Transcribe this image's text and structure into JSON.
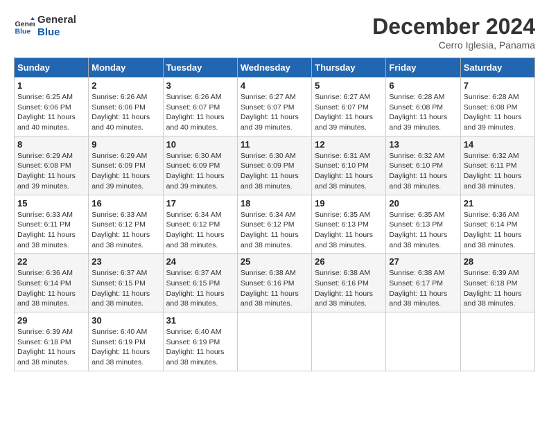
{
  "header": {
    "logo_general": "General",
    "logo_blue": "Blue",
    "month_year": "December 2024",
    "location": "Cerro Iglesia, Panama"
  },
  "columns": [
    "Sunday",
    "Monday",
    "Tuesday",
    "Wednesday",
    "Thursday",
    "Friday",
    "Saturday"
  ],
  "weeks": [
    [
      {
        "day": "1",
        "info": "Sunrise: 6:25 AM\nSunset: 6:06 PM\nDaylight: 11 hours and 40 minutes."
      },
      {
        "day": "2",
        "info": "Sunrise: 6:26 AM\nSunset: 6:06 PM\nDaylight: 11 hours and 40 minutes."
      },
      {
        "day": "3",
        "info": "Sunrise: 6:26 AM\nSunset: 6:07 PM\nDaylight: 11 hours and 40 minutes."
      },
      {
        "day": "4",
        "info": "Sunrise: 6:27 AM\nSunset: 6:07 PM\nDaylight: 11 hours and 39 minutes."
      },
      {
        "day": "5",
        "info": "Sunrise: 6:27 AM\nSunset: 6:07 PM\nDaylight: 11 hours and 39 minutes."
      },
      {
        "day": "6",
        "info": "Sunrise: 6:28 AM\nSunset: 6:08 PM\nDaylight: 11 hours and 39 minutes."
      },
      {
        "day": "7",
        "info": "Sunrise: 6:28 AM\nSunset: 6:08 PM\nDaylight: 11 hours and 39 minutes."
      }
    ],
    [
      {
        "day": "8",
        "info": "Sunrise: 6:29 AM\nSunset: 6:08 PM\nDaylight: 11 hours and 39 minutes."
      },
      {
        "day": "9",
        "info": "Sunrise: 6:29 AM\nSunset: 6:09 PM\nDaylight: 11 hours and 39 minutes."
      },
      {
        "day": "10",
        "info": "Sunrise: 6:30 AM\nSunset: 6:09 PM\nDaylight: 11 hours and 39 minutes."
      },
      {
        "day": "11",
        "info": "Sunrise: 6:30 AM\nSunset: 6:09 PM\nDaylight: 11 hours and 38 minutes."
      },
      {
        "day": "12",
        "info": "Sunrise: 6:31 AM\nSunset: 6:10 PM\nDaylight: 11 hours and 38 minutes."
      },
      {
        "day": "13",
        "info": "Sunrise: 6:32 AM\nSunset: 6:10 PM\nDaylight: 11 hours and 38 minutes."
      },
      {
        "day": "14",
        "info": "Sunrise: 6:32 AM\nSunset: 6:11 PM\nDaylight: 11 hours and 38 minutes."
      }
    ],
    [
      {
        "day": "15",
        "info": "Sunrise: 6:33 AM\nSunset: 6:11 PM\nDaylight: 11 hours and 38 minutes."
      },
      {
        "day": "16",
        "info": "Sunrise: 6:33 AM\nSunset: 6:12 PM\nDaylight: 11 hours and 38 minutes."
      },
      {
        "day": "17",
        "info": "Sunrise: 6:34 AM\nSunset: 6:12 PM\nDaylight: 11 hours and 38 minutes."
      },
      {
        "day": "18",
        "info": "Sunrise: 6:34 AM\nSunset: 6:12 PM\nDaylight: 11 hours and 38 minutes."
      },
      {
        "day": "19",
        "info": "Sunrise: 6:35 AM\nSunset: 6:13 PM\nDaylight: 11 hours and 38 minutes."
      },
      {
        "day": "20",
        "info": "Sunrise: 6:35 AM\nSunset: 6:13 PM\nDaylight: 11 hours and 38 minutes."
      },
      {
        "day": "21",
        "info": "Sunrise: 6:36 AM\nSunset: 6:14 PM\nDaylight: 11 hours and 38 minutes."
      }
    ],
    [
      {
        "day": "22",
        "info": "Sunrise: 6:36 AM\nSunset: 6:14 PM\nDaylight: 11 hours and 38 minutes."
      },
      {
        "day": "23",
        "info": "Sunrise: 6:37 AM\nSunset: 6:15 PM\nDaylight: 11 hours and 38 minutes."
      },
      {
        "day": "24",
        "info": "Sunrise: 6:37 AM\nSunset: 6:15 PM\nDaylight: 11 hours and 38 minutes."
      },
      {
        "day": "25",
        "info": "Sunrise: 6:38 AM\nSunset: 6:16 PM\nDaylight: 11 hours and 38 minutes."
      },
      {
        "day": "26",
        "info": "Sunrise: 6:38 AM\nSunset: 6:16 PM\nDaylight: 11 hours and 38 minutes."
      },
      {
        "day": "27",
        "info": "Sunrise: 6:38 AM\nSunset: 6:17 PM\nDaylight: 11 hours and 38 minutes."
      },
      {
        "day": "28",
        "info": "Sunrise: 6:39 AM\nSunset: 6:18 PM\nDaylight: 11 hours and 38 minutes."
      }
    ],
    [
      {
        "day": "29",
        "info": "Sunrise: 6:39 AM\nSunset: 6:18 PM\nDaylight: 11 hours and 38 minutes."
      },
      {
        "day": "30",
        "info": "Sunrise: 6:40 AM\nSunset: 6:19 PM\nDaylight: 11 hours and 38 minutes."
      },
      {
        "day": "31",
        "info": "Sunrise: 6:40 AM\nSunset: 6:19 PM\nDaylight: 11 hours and 38 minutes."
      },
      null,
      null,
      null,
      null
    ]
  ]
}
